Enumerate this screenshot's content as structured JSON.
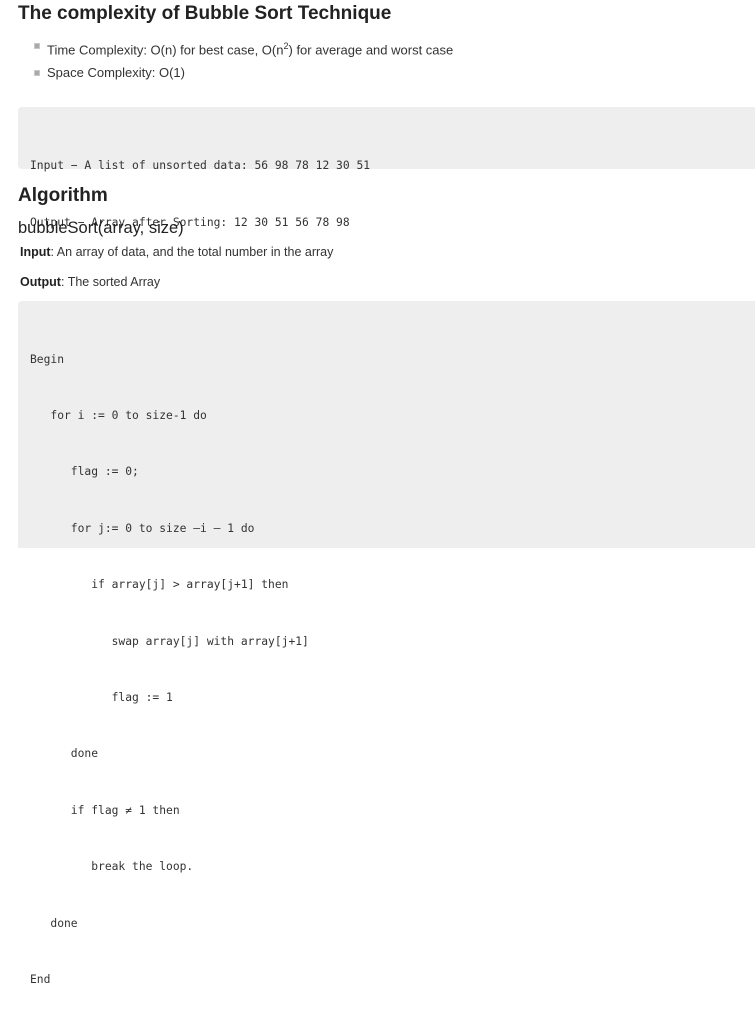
{
  "complexity": {
    "title": "The complexity of Bubble Sort Technique",
    "items": [
      {
        "label": "Time Complexity: O(n) for best case, O(n",
        "sup": "2",
        "rest": ") for average and worst case"
      },
      {
        "label": "Space Complexity: O(1)",
        "sup": "",
        "rest": ""
      }
    ]
  },
  "example": {
    "lines": [
      "Input − A list of unsorted data: 56 98 78 12 30 51",
      "Output − Array after Sorting: 12 30 51 56 78 98"
    ]
  },
  "algorithm": {
    "heading": "Algorithm",
    "function_signature": "bubbleSort(array, size)",
    "input_label": "Input",
    "input_text": ": An array of data, and the total number in the array",
    "output_label": "Output",
    "output_text": ": The sorted Array",
    "code_lines": [
      "Begin",
      "   for i := 0 to size-1 do",
      "      flag := 0;",
      "      for j:= 0 to size –i – 1 do",
      "         if array[j] > array[j+1] then",
      "            swap array[j] with array[j+1]",
      "            flag := 1",
      "      done",
      "      if flag ≠ 1 then",
      "         break the loop.",
      "   done",
      "End"
    ]
  }
}
